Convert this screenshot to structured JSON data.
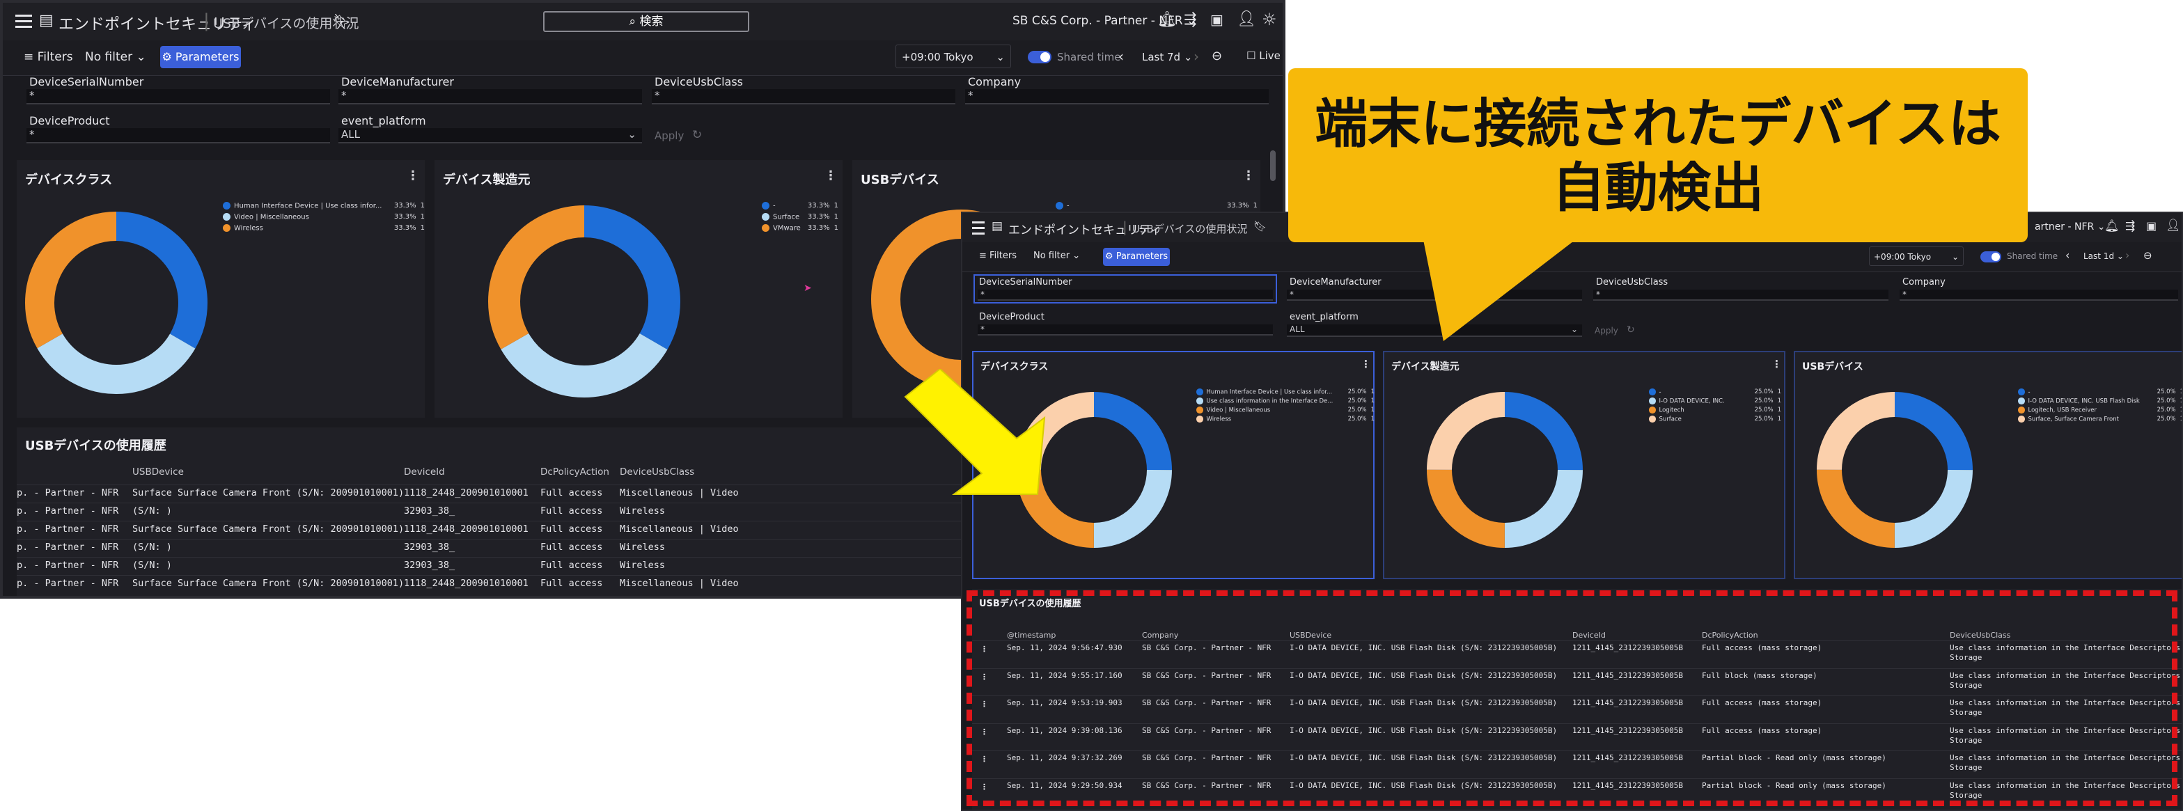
{
  "app": {
    "title": "エンドポイントセキュリティ",
    "page": "USBデバイスの使用状況",
    "search_label": "検索",
    "tenant": "SB C&S Corp. - Partner - NFR",
    "tenant_short": "artner - NFR"
  },
  "filterbar": {
    "filters_label": "Filters",
    "no_filter_label": "No filter",
    "parameters_label": "Parameters",
    "timezone": "+09:00 Tokyo",
    "shared_time_label": "Shared time",
    "range1": "Last 7d",
    "range2": "Last 1d",
    "live_label": "Live"
  },
  "params": {
    "serial_label": "DeviceSerialNumber",
    "serial_value": "*",
    "manufacturer_label": "DeviceManufacturer",
    "manufacturer_value": "*",
    "usbclass_label": "DeviceUsbClass",
    "usbclass_value": "*",
    "company_label": "Company",
    "company_value": "*",
    "product_label": "DeviceProduct",
    "product_value": "*",
    "platform_label": "event_platform",
    "platform_value": "ALL",
    "apply_label": "Apply"
  },
  "panels1": {
    "class_title": "デバイスクラス",
    "manu_title": "デバイス製造元",
    "usb_title": "USBデバイス",
    "class_legend": [
      {
        "label": "Human Interface Device | Use class infor...",
        "pct": "33.3%",
        "count": "1",
        "color": "#1e6ed8"
      },
      {
        "label": "Video | Miscellaneous",
        "pct": "33.3%",
        "count": "1",
        "color": "#b6dcf5"
      },
      {
        "label": "Wireless",
        "pct": "33.3%",
        "count": "1",
        "color": "#f0922b"
      }
    ],
    "manu_legend": [
      {
        "label": "-",
        "pct": "33.3%",
        "count": "1",
        "color": "#1e6ed8"
      },
      {
        "label": "Surface",
        "pct": "33.3%",
        "count": "1",
        "color": "#b6dcf5"
      },
      {
        "label": "VMware",
        "pct": "33.3%",
        "count": "1",
        "color": "#f0922b"
      }
    ],
    "usb_legend": [
      {
        "label": "-",
        "pct": "33.3%",
        "count": "1",
        "color": "#1e6ed8"
      }
    ],
    "history_title": "USBデバイスの使用履歴",
    "history_columns": [
      "USBDevice",
      "DeviceId",
      "DcPolicyAction",
      "DeviceUsbClass"
    ],
    "history_rows": [
      [
        "p. - Partner - NFR",
        "Surface Surface Camera Front (S/N: 200901010001)",
        "1118_2448_200901010001",
        "Full access",
        "Miscellaneous | Video"
      ],
      [
        "p. - Partner - NFR",
        "  (S/N: )",
        "32903_38_",
        "Full access",
        "Wireless"
      ],
      [
        "p. - Partner - NFR",
        "Surface Surface Camera Front (S/N: 200901010001)",
        "1118_2448_200901010001",
        "Full access",
        "Miscellaneous | Video"
      ],
      [
        "p. - Partner - NFR",
        "  (S/N: )",
        "32903_38_",
        "Full access",
        "Wireless"
      ],
      [
        "p. - Partner - NFR",
        "  (S/N: )",
        "32903_38_",
        "Full access",
        "Wireless"
      ],
      [
        "p. - Partner - NFR",
        "Surface Surface Camera Front (S/N: 200901010001)",
        "1118_2448_200901010001",
        "Full access",
        "Miscellaneous | Video"
      ]
    ]
  },
  "panels2": {
    "class_legend": [
      {
        "label": "Human Interface Device | Use class infor...",
        "pct": "25.0%",
        "count": "1",
        "color": "#1e6ed8"
      },
      {
        "label": "Use class information in the Interface De...",
        "pct": "25.0%",
        "count": "1",
        "color": "#b6dcf5"
      },
      {
        "label": "Video | Miscellaneous",
        "pct": "25.0%",
        "count": "1",
        "color": "#f0922b"
      },
      {
        "label": "Wireless",
        "pct": "25.0%",
        "count": "1",
        "color": "#fbd0ac"
      }
    ],
    "manu_legend": [
      {
        "label": "-",
        "pct": "25.0%",
        "count": "1",
        "color": "#1e6ed8"
      },
      {
        "label": "I-O DATA DEVICE, INC.",
        "pct": "25.0%",
        "count": "1",
        "color": "#b6dcf5"
      },
      {
        "label": "Logitech",
        "pct": "25.0%",
        "count": "1",
        "color": "#f0922b"
      },
      {
        "label": "Surface",
        "pct": "25.0%",
        "count": "1",
        "color": "#fbd0ac"
      }
    ],
    "usb_legend": [
      {
        "label": "-",
        "pct": "25.0%",
        "count": "1",
        "color": "#1e6ed8"
      },
      {
        "label": "I-O DATA DEVICE, INC. USB Flash Disk",
        "pct": "25.0%",
        "count": "1",
        "color": "#b6dcf5"
      },
      {
        "label": "Logitech, USB Receiver",
        "pct": "25.0%",
        "count": "1",
        "color": "#f0922b"
      },
      {
        "label": "Surface, Surface Camera Front",
        "pct": "25.0%",
        "count": "1",
        "color": "#fbd0ac"
      }
    ],
    "history_columns": [
      "@timestamp",
      "Company",
      "USBDevice",
      "DeviceId",
      "DcPolicyAction",
      "DeviceUsbClass"
    ],
    "history_rows": [
      [
        "Sep. 11, 2024 9:56:47.930",
        "SB C&S Corp. - Partner - NFR",
        "I-O DATA DEVICE, INC. USB Flash Disk (S/N: 2312239305005B)",
        "1211_4145_2312239305005B",
        "Full access (mass storage)",
        "Use class information in the Interface Descriptors",
        "Storage"
      ],
      [
        "Sep. 11, 2024 9:55:17.160",
        "SB C&S Corp. - Partner - NFR",
        "I-O DATA DEVICE, INC. USB Flash Disk (S/N: 2312239305005B)",
        "1211_4145_2312239305005B",
        "Full block (mass storage)",
        "Use class information in the Interface Descriptors",
        "Storage"
      ],
      [
        "Sep. 11, 2024 9:53:19.903",
        "SB C&S Corp. - Partner - NFR",
        "I-O DATA DEVICE, INC. USB Flash Disk (S/N: 2312239305005B)",
        "1211_4145_2312239305005B",
        "Full access (mass storage)",
        "Use class information in the Interface Descriptors",
        "Storage"
      ],
      [
        "Sep. 11, 2024 9:39:08.136",
        "SB C&S Corp. - Partner - NFR",
        "I-O DATA DEVICE, INC. USB Flash Disk (S/N: 2312239305005B)",
        "1211_4145_2312239305005B",
        "Full access (mass storage)",
        "Use class information in the Interface Descriptors",
        "Storage"
      ],
      [
        "Sep. 11, 2024 9:37:32.269",
        "SB C&S Corp. - Partner - NFR",
        "I-O DATA DEVICE, INC. USB Flash Disk (S/N: 2312239305005B)",
        "1211_4145_2312239305005B",
        "Partial block - Read only (mass storage)",
        "Use class information in the Interface Descriptors",
        "Storage"
      ],
      [
        "Sep. 11, 2024 9:29:50.934",
        "SB C&S Corp. - Partner - NFR",
        "I-O DATA DEVICE, INC. USB Flash Disk (S/N: 2312239305005B)",
        "1211_4145_2312239305005B",
        "Partial block - Read only (mass storage)",
        "Use class information in the Interface Descriptors",
        "Storage"
      ]
    ]
  },
  "callout": {
    "line1": "端末に接続されたデバイスは",
    "line2": "自動検出"
  }
}
